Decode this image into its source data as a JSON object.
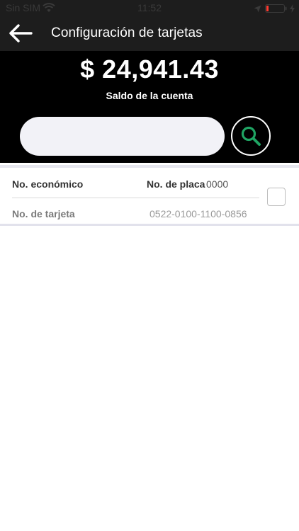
{
  "status_bar": {
    "carrier": "Sin SIM",
    "time": "11:52"
  },
  "nav": {
    "title": "Configuración de tarjetas"
  },
  "account": {
    "balance": "$ 24,941.43",
    "balance_label": "Saldo de la cuenta"
  },
  "search": {
    "value": "",
    "placeholder": ""
  },
  "cards": [
    {
      "economic_label": "No. económico",
      "economic_value": "",
      "plate_label": "No. de placa",
      "plate_value": "0000",
      "card_label": "No. de tarjeta",
      "card_value": "0522-0100-1100-0856",
      "selected": false
    }
  ],
  "colors": {
    "nav_bg": "#1d1d1d",
    "header_bg": "#000000",
    "search_icon": "#1fa463",
    "input_bg": "#f2f2f7",
    "battery_low": "#ff3b30"
  },
  "icons": {
    "back": "arrow-left-icon",
    "search": "magnifier-icon",
    "wifi": "wifi-icon",
    "location": "location-arrow-icon",
    "battery": "battery-icon",
    "charging": "bolt-icon"
  }
}
